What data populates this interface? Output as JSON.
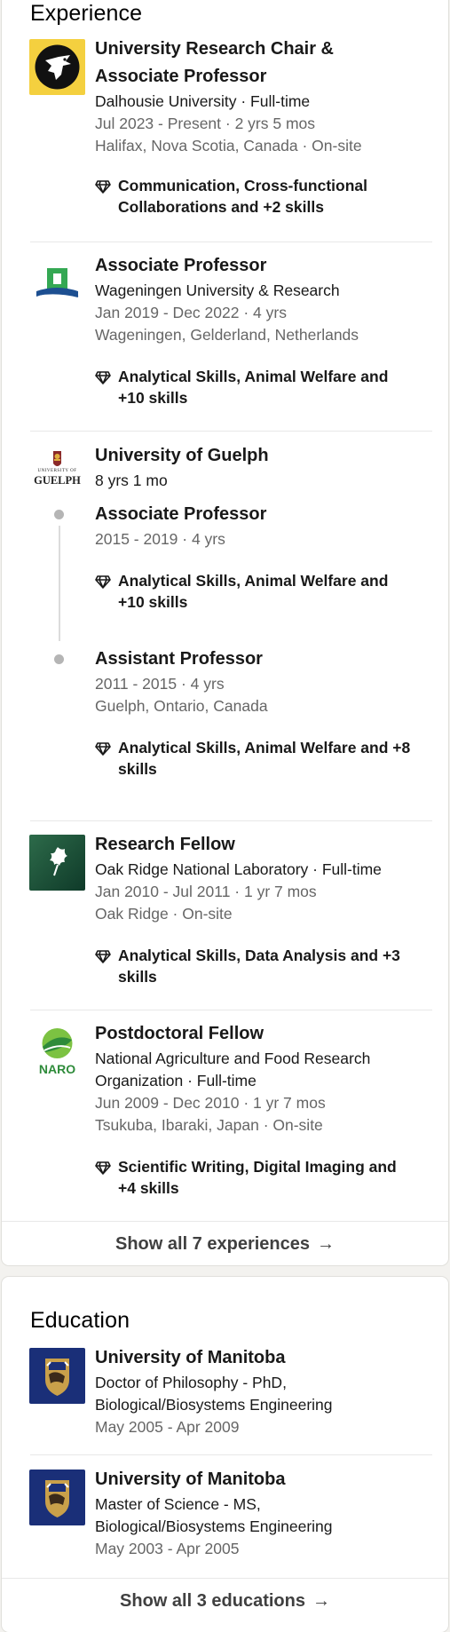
{
  "experience": {
    "title": "Experience",
    "entries": [
      {
        "role": "University Research Chair &",
        "role2": "Associate Professor",
        "org": "Dalhousie University · Full-time",
        "dates": "Jul 2023 - Present · 2 yrs 5 mos",
        "location": "Halifax, Nova Scotia, Canada · On-site",
        "skills1": "Communication, Cross-functional",
        "skills2": "Collaborations and +2 skills",
        "logo": "dalhousie-logo"
      },
      {
        "role": "Associate Professor",
        "org": "Wageningen University & Research",
        "dates": "Jan 2019 - Dec 2022 · 4 yrs",
        "location": "Wageningen, Gelderland, Netherlands",
        "skills1": "Analytical Skills, Animal Welfare and",
        "skills2": "+10 skills",
        "logo": "wageningen-logo"
      },
      {
        "org": "University of Guelph",
        "duration": "8 yrs 1 mo",
        "logo_text_top": "UNIVERSITY OF",
        "logo_text": "GUELPH",
        "positions": [
          {
            "role": "Associate Professor",
            "dates": "2015 - 2019 · 4 yrs",
            "skills1": "Analytical Skills, Animal Welfare and",
            "skills2": "+10 skills"
          },
          {
            "role": "Assistant Professor",
            "dates": "2011 - 2015 · 4 yrs",
            "location": "Guelph, Ontario, Canada",
            "skills1": "Analytical Skills, Animal Welfare and +8",
            "skills2": "skills"
          }
        ]
      },
      {
        "role": "Research Fellow",
        "org": "Oak Ridge National Laboratory · Full-time",
        "dates": "Jan 2010 - Jul 2011 · 1 yr 7 mos",
        "location": "Oak Ridge · On-site",
        "skills1": "Analytical Skills, Data Analysis and +3",
        "skills2": "skills",
        "logo": "oak-ridge-logo"
      },
      {
        "role": "Postdoctoral Fellow",
        "org": "National Agriculture and Food Research",
        "org2": "Organization · Full-time",
        "dates": "Jun 2009 - Dec 2010 · 1 yr 7 mos",
        "location": "Tsukuba, Ibaraki, Japan · On-site",
        "skills1": "Scientific Writing, Digital Imaging and",
        "skills2": "+4 skills",
        "logo_text": "NARO"
      }
    ],
    "show_all": "Show all 7 experiences",
    "arrow": "→"
  },
  "education": {
    "title": "Education",
    "entries": [
      {
        "school": "University of Manitoba",
        "degree": "Doctor of Philosophy - PhD,",
        "field": "Biological/Biosystems Engineering",
        "dates": "May 2005 - Apr 2009"
      },
      {
        "school": "University of Manitoba",
        "degree": "Master of Science - MS,",
        "field": "Biological/Biosystems Engineering",
        "dates": "May 2003 - Apr 2005"
      }
    ],
    "show_all": "Show all 3 educations",
    "arrow": "→"
  },
  "colors": {
    "dalhousie_yellow": "#f4d03f",
    "wageningen_green": "#34a853",
    "wageningen_blue": "#1d4f91",
    "naro_green": "#2e8b3a",
    "oakridge_green": "#1f5a3c",
    "manitoba_blue": "#1a2f78",
    "manitoba_gold": "#c9a04a"
  }
}
